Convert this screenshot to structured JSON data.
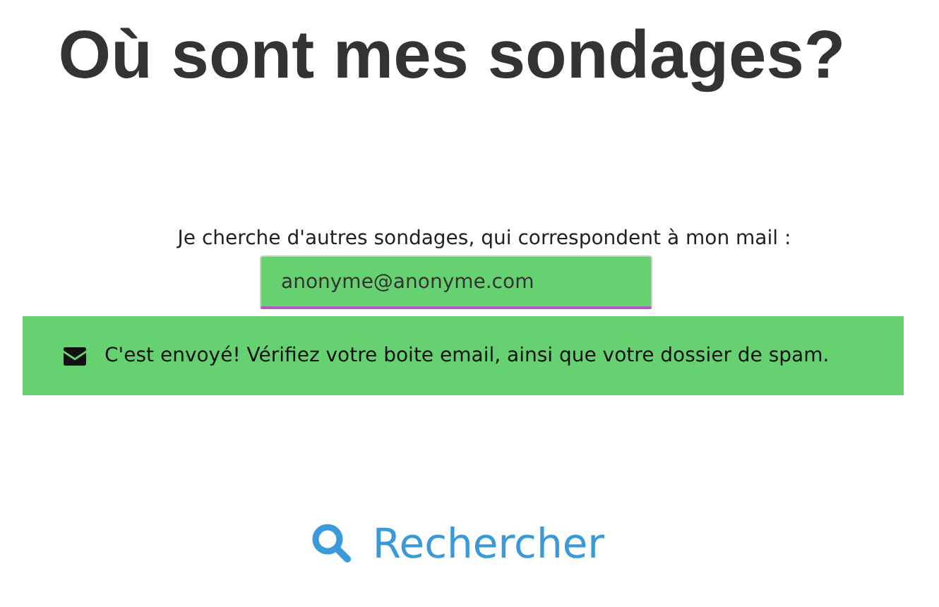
{
  "title": "Où sont mes sondages?",
  "search": {
    "label": "Je cherche d'autres sondages, qui correspondent à mon mail :",
    "value": "anonyme@anonyme.com"
  },
  "alert": {
    "kind": "success",
    "message": "C'est envoyé! Vérifiez votre boite email, ainsi que votre dossier de spam."
  },
  "button": "Rechercher"
}
